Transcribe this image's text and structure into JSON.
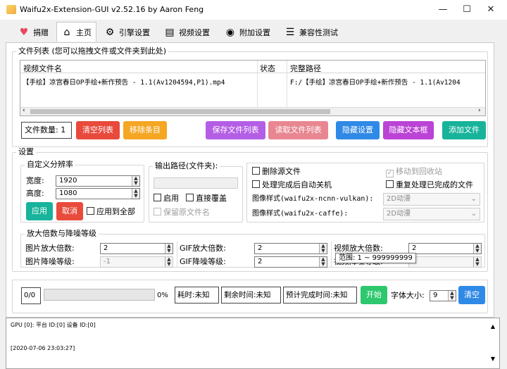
{
  "window": {
    "title": "Waifu2x-Extension-GUI v2.52.16 by Aaron Feng",
    "minimize": "—",
    "maximize": "☐",
    "close": "✕"
  },
  "tabs": [
    {
      "label": "捐赠",
      "icon": "heart-icon"
    },
    {
      "label": "主页",
      "icon": "home-icon"
    },
    {
      "label": "引擎设置",
      "icon": "engine-icon"
    },
    {
      "label": "视频设置",
      "icon": "clapperboard-icon"
    },
    {
      "label": "附加设置",
      "icon": "settings-icon"
    },
    {
      "label": "兼容性测试",
      "icon": "checklist-icon"
    }
  ],
  "file_list": {
    "group_title": "文件列表 (您可以拖拽文件或文件夹到此处)",
    "columns": [
      "视频文件名",
      "状态",
      "完整路径"
    ],
    "rows": [
      {
        "name": "【手绘】凉宫春日OP手绘+新作预告 - 1.1(Av1204594,P1).mp4",
        "status": "",
        "path": "F:/【手绘】凉宫春日OP手绘+新作预告 - 1.1(Av1204"
      }
    ],
    "file_count": "文件数量: 1",
    "buttons": {
      "clear": "清空列表",
      "remove": "移除条目",
      "save": "保存文件列表",
      "load": "读取文件列表",
      "hide_settings": "隐藏设置",
      "hide_textbox": "隐藏文本框",
      "add_file": "添加文件"
    }
  },
  "colors": {
    "red": "#e84a3c",
    "orange": "#f5a623",
    "purple": "#b45ee6",
    "pink": "#e88791",
    "blue": "#2f89e6",
    "magenta": "#bb43d6",
    "teal": "#17b39a",
    "green": "#2dc76d"
  },
  "settings": {
    "group_title": "设置",
    "custom_res": {
      "title": "自定义分辨率",
      "width_label": "宽度:",
      "width": "1920",
      "height_label": "高度:",
      "height": "1080",
      "apply": "应用",
      "cancel": "取消",
      "apply_all": "应用到全部"
    },
    "output": {
      "title": "输出路径(文件夹):",
      "enable": "启用",
      "overwrite": "直接覆盖",
      "keep_name": "保留原文件名"
    },
    "options": {
      "delete_source": "删除源文件",
      "recycle": "移动到回收站",
      "shutdown": "处理完成后自动关机",
      "reprocess": "重复处理已完成的文件",
      "style_ncnn_label": "图像样式(waifu2x-ncnn-vulkan):",
      "style_ncnn": "2D动漫",
      "style_caffe_label": "图像样式(waifu2x-caffe):",
      "style_caffe": "2D动漫"
    },
    "scale": {
      "title": "放大倍数与降噪等级",
      "img_scale_label": "图片放大倍数:",
      "img_scale": "2",
      "img_noise_label": "图片降噪等级:",
      "img_noise": "-1",
      "gif_scale_label": "GIF放大倍数:",
      "gif_scale": "2",
      "gif_noise_label": "GIF降噪等级:",
      "gif_noise": "2",
      "video_scale_label": "视频放大倍数:",
      "video_scale": "2",
      "video_noise_label": "视频降噪等级:",
      "video_noise": "1",
      "tooltip": "范围: 1 ~ 999999999"
    }
  },
  "progress": {
    "count": "0/0",
    "percent": "0%",
    "value": 0,
    "elapsed": "耗时:未知",
    "remaining": "剩余时间:未知",
    "eta": "预计完成时间:未知",
    "start": "开始",
    "font_size_label": "字体大小:",
    "font_size": "9",
    "clear": "清空"
  },
  "log": {
    "line1": "GPU [0]: 平台 ID:[0] 设备 ID:[0]",
    "line2": "[2020-07-06 23:03:27]"
  }
}
